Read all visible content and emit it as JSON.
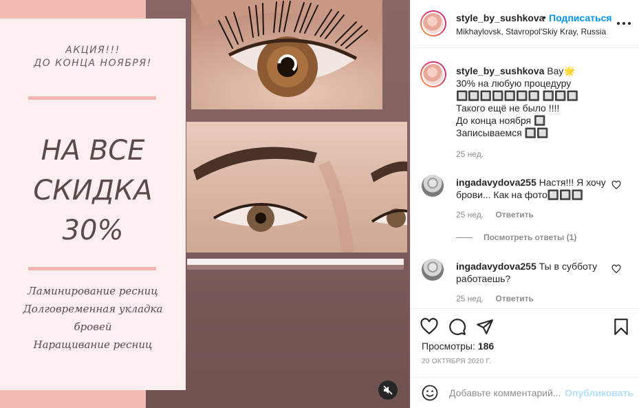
{
  "media": {
    "promo_small_line1": "АКЦИЯ!!!",
    "promo_small_line2": "ДО КОНЦА НОЯБРЯ!",
    "promo_big_line1": "НА ВСЕ",
    "promo_big_line2": "СКИДКА",
    "promo_big_line3": "30%",
    "services": [
      "Ламинирование ресниц",
      "Долговременная укладка",
      "бровей",
      "Наращивание ресниц"
    ],
    "colors": {
      "pink": "#f2bcb4",
      "card": "#fbeff0",
      "mauve": "#8a6767"
    },
    "mute_icon": "speaker-muted-icon"
  },
  "header": {
    "username": "style_by_sushkova",
    "separator": "•",
    "follow_label": "Подписаться",
    "location": "Mikhaylovsk, Stavropol'Skiy Kray, Russia",
    "more_icon": "more-options-icon"
  },
  "caption": {
    "username": "style_by_sushkova",
    "line1": "Вау🌟",
    "line2": "30% на любую процедуру 🔲🔲🔲🔲🔲🔲🔲 🔲🔲🔲",
    "line3": "Такого ещё не было !!!!",
    "line4": "До конца ноября 🔲",
    "line5": "Записываемся 🔲🔲",
    "time": "25 нед."
  },
  "comments": [
    {
      "username": "ingadavydova255",
      "text": "Настя!!! Я хочу брови... Как на фото🔲🔲🔲",
      "time": "25 нед.",
      "reply_label": "Ответить"
    },
    {
      "username": "ingadavydova255",
      "text": "Ты в субботу работаешь?",
      "time": "25 нед.",
      "reply_label": "Ответить"
    }
  ],
  "view_replies_label": "Посмотреть ответы (1)",
  "actions": {
    "views_label": "Просмотры:",
    "views_count": "186",
    "date": "20 ОКТЯБРЯ 2020 Г.",
    "icons": [
      "heart-icon",
      "comment-icon",
      "share-icon",
      "bookmark-icon"
    ]
  },
  "add_comment": {
    "placeholder": "Добавьте комментарий...",
    "publish_label": "Опубликовать",
    "accent": "#0095f6"
  }
}
